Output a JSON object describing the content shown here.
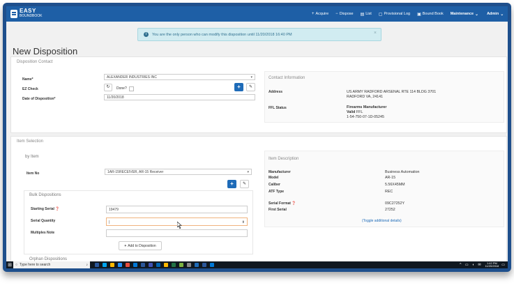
{
  "navbar": {
    "logo_line1": "EASY",
    "logo_line2": "BOUNDBOOK",
    "items": [
      {
        "icon": "plus-icon",
        "glyph": "+",
        "label": "Acquire"
      },
      {
        "icon": "minus-icon",
        "glyph": "−",
        "label": "Dispose"
      },
      {
        "icon": "list-icon",
        "glyph": "▤",
        "label": "List"
      },
      {
        "icon": "file-icon",
        "glyph": "▢",
        "label": "Provisional Log"
      },
      {
        "icon": "book-icon",
        "glyph": "▣",
        "label": "Bound Book"
      }
    ],
    "maintenance": "Maintenance",
    "admin": "Admin"
  },
  "alert": {
    "text": "You are the only person who can modify this disposition until 11/20/2018 16:40 PM",
    "close": "×"
  },
  "page_title": "New Disposition",
  "disposition_contact": {
    "heading": "Disposition Contact",
    "name_label": "Name*",
    "name_value": "ALEXANDER INDUSTRIES INC",
    "ez_check_label": "EZ Check",
    "done_label": "Done?",
    "date_label": "Date of Disposition*",
    "date_value": "11/20/2018",
    "contact_info_heading": "Contact Information",
    "address_label": "Address",
    "address_line1": "US ARMY RADFORD ARSENAL RTE 114 BLDG 3701",
    "address_line2": "RADFORD VA, 24141",
    "ffl_status_label": "FFL Status",
    "ffl_type": "Firearms Manufacturer",
    "ffl_valid": "Valid",
    "ffl_valid_suffix": "FFL",
    "ffl_number": "1-54-750-07-1D-05245"
  },
  "item_selection": {
    "heading": "Item Selection",
    "by_item_heading": "by Item",
    "item_no_label": "Item No",
    "item_no_value": "1AR-15RECEIVER, AR-15 Receiver",
    "bulk_heading": "Bulk Dispositions",
    "starting_serial_label": "Starting Serial",
    "starting_serial_value": "19479",
    "serial_quantity_label": "Serial Quantity",
    "serial_quantity_value": "|",
    "multiples_note_label": "Multiples Note",
    "multiples_note_value": "",
    "add_button": "Add to Disposition",
    "orphan_heading": "Orphan Dispositions",
    "description_heading": "Item Description",
    "description": [
      {
        "label": "Manufacturer",
        "value": "Business Automation"
      },
      {
        "label": "Model",
        "value": "AR-15"
      },
      {
        "label": "Caliber",
        "value": "5.56X45MM"
      },
      {
        "label": "ATF Type",
        "value": "REC"
      }
    ],
    "serial_format_label": "Serial Format",
    "serial_format_value": "09C27252Y",
    "first_serial_label": "First Serial",
    "first_serial_value": "27252",
    "toggle_link": "(Toggle additional details)"
  },
  "taskbar": {
    "search_placeholder": "Type here to search",
    "time": "1:42 PM",
    "date": "11/20/2018",
    "apps": [
      "#2b579a",
      "#00a4ef",
      "#ffb900",
      "#1e90ff",
      "#e74c3c",
      "#0078d7",
      "#2b579a",
      "#3f51b5",
      "#0063b1",
      "#ffb900",
      "#217346",
      "#7cb342",
      "#888888",
      "#1e6bb8",
      "#2b579a",
      "#0078d7"
    ]
  }
}
